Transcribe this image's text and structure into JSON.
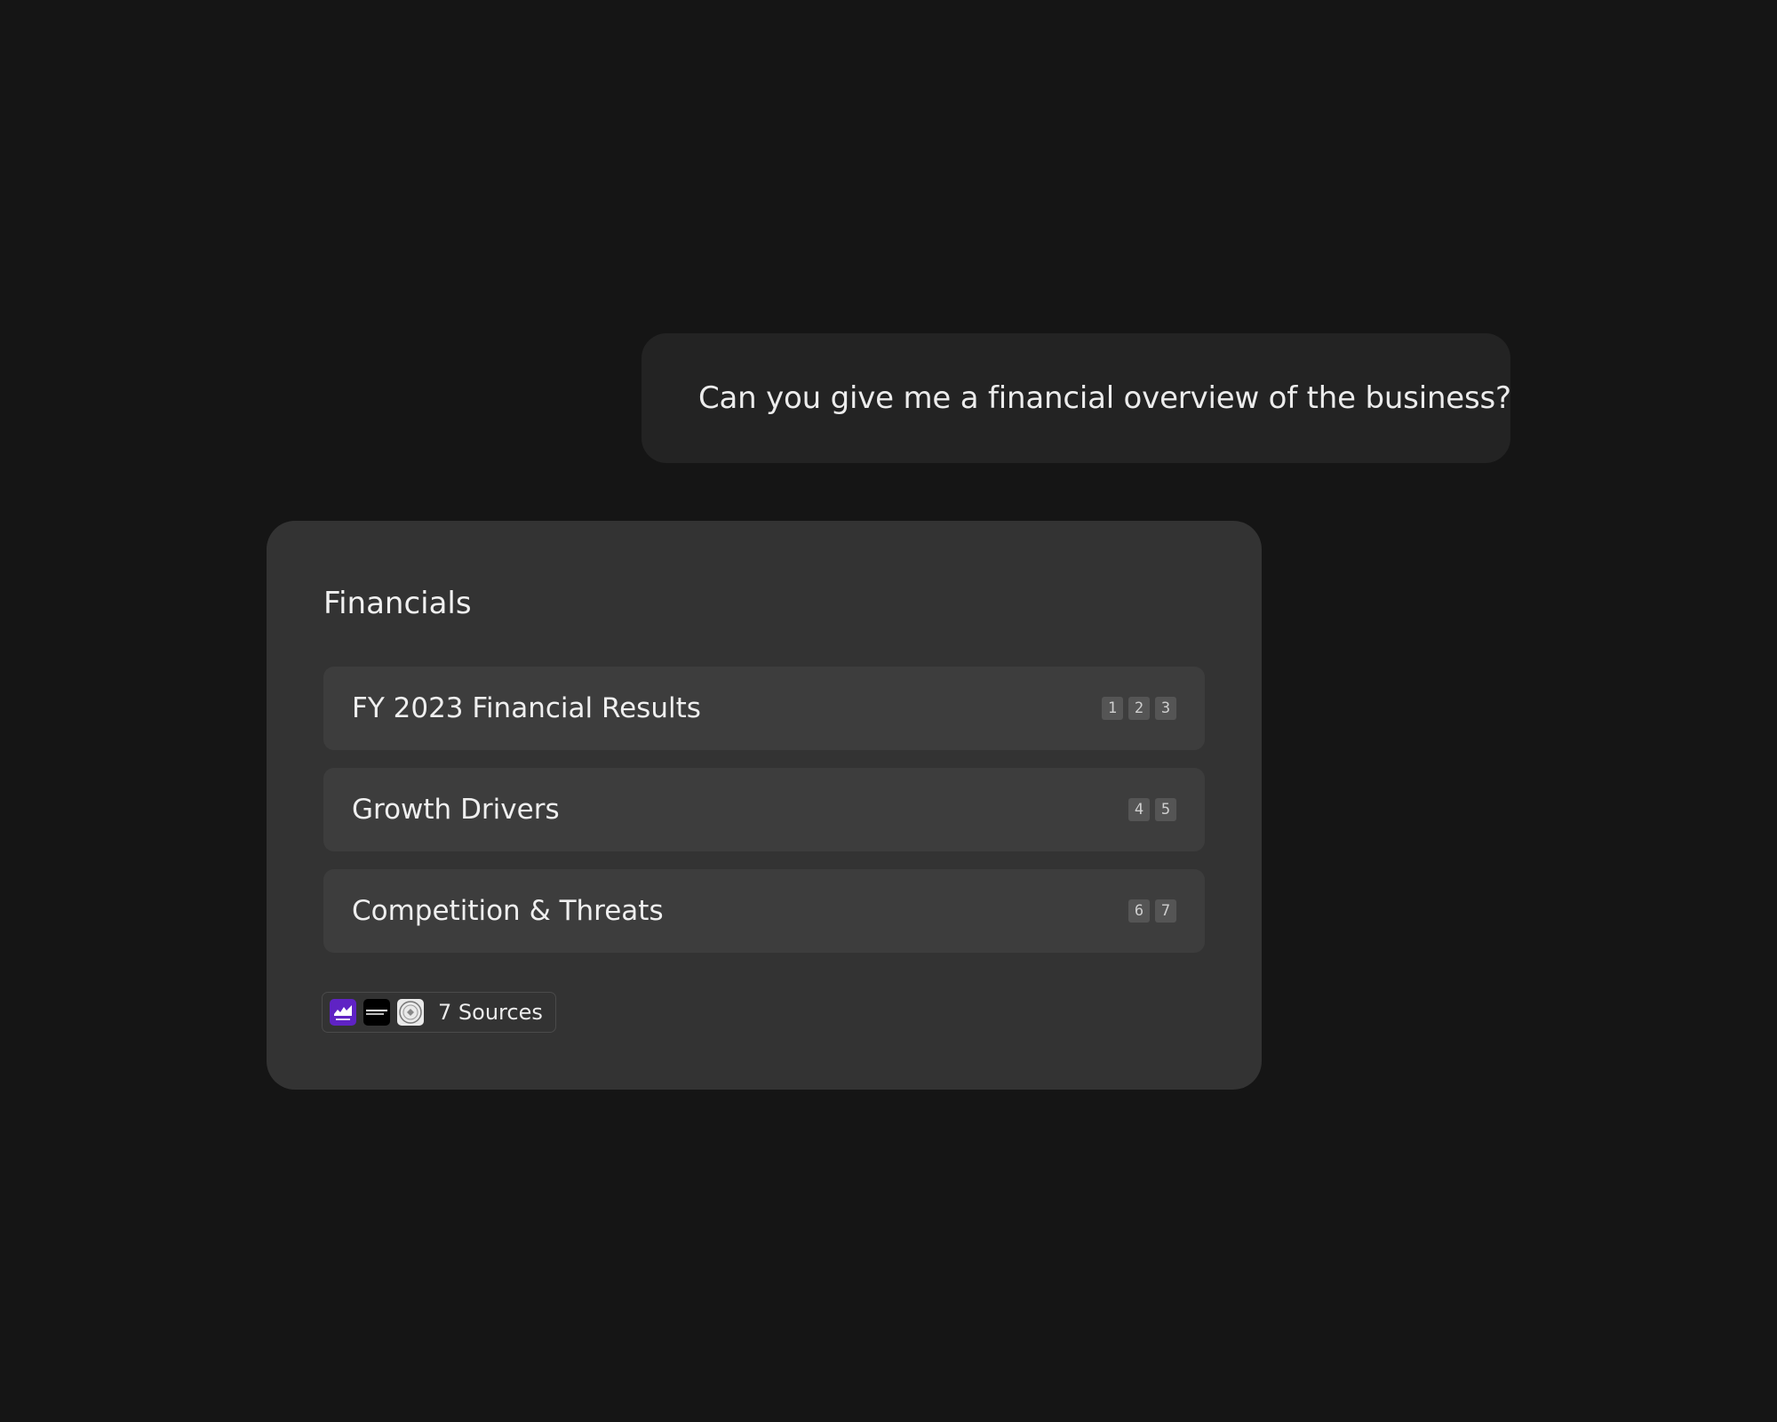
{
  "user_message": {
    "text": "Can you give me a financial overview of the business?"
  },
  "card": {
    "title": "Financials",
    "rows": [
      {
        "label": "FY 2023 Financial Results",
        "citations": [
          "1",
          "2",
          "3"
        ]
      },
      {
        "label": "Growth Drivers",
        "citations": [
          "4",
          "5"
        ]
      },
      {
        "label": "Competition & Threats",
        "citations": [
          "6",
          "7"
        ]
      }
    ],
    "sources": {
      "label": "7 Sources",
      "icons": [
        "yahoo-finance-logo",
        "bloomberg-logo",
        "sec-seal-logo"
      ]
    }
  },
  "colors": {
    "background": "#151515",
    "user_bubble": "#232323",
    "card": "#333333",
    "row": "#3d3d3d",
    "citation_badge": "#555555",
    "yahoo_purple": "#5f23c4"
  }
}
